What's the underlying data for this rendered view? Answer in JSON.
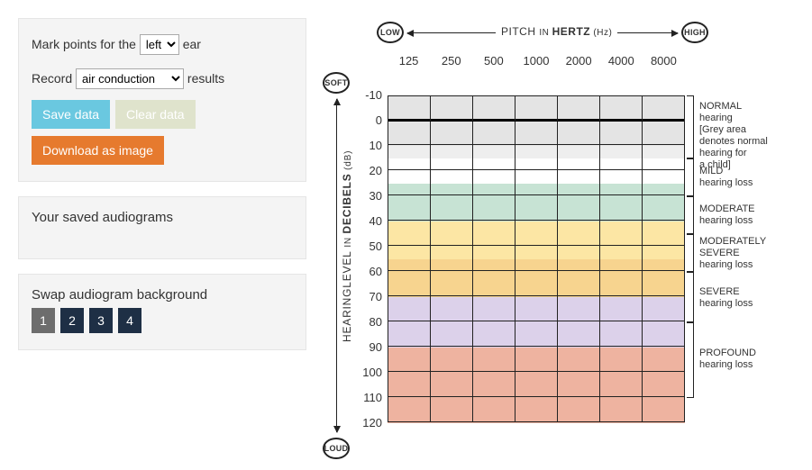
{
  "controls": {
    "mark_prefix": "Mark points for the ",
    "mark_suffix": " ear",
    "ear_value": "left",
    "record_prefix": "Record ",
    "record_suffix": " results",
    "conduction_value": "air conduction",
    "save_label": "Save data",
    "clear_label": "Clear data",
    "download_label": "Download as image"
  },
  "saved": {
    "heading": "Your saved audiograms"
  },
  "swap": {
    "heading": "Swap audiogram background",
    "options": [
      "1",
      "2",
      "3",
      "4"
    ],
    "active": "1"
  },
  "chart_data": {
    "type": "heatmap",
    "title_x_main": "PITCH ",
    "title_x_sub": "IN ",
    "title_x_sub2": "HERTZ",
    "title_x_sub3": " (Hz)",
    "title_y_main": "HEARINGLEVEL ",
    "title_y_sub": "IN ",
    "title_y_sub2": "DECIBELS",
    "title_y_sub3": " (dB)",
    "badge_low": "LOW",
    "badge_high": "HIGH",
    "badge_soft": "SOFT",
    "badge_loud": "LOUD",
    "x_ticks": [
      "125",
      "250",
      "500",
      "1000",
      "2000",
      "4000",
      "8000"
    ],
    "y_ticks": [
      "-10",
      "0",
      "10",
      "20",
      "30",
      "40",
      "50",
      "60",
      "70",
      "80",
      "90",
      "100",
      "110",
      "120"
    ],
    "bands": [
      {
        "from": -10,
        "to": 0,
        "color": "c-grey"
      },
      {
        "from": 0,
        "to": 10,
        "color": "c-grey"
      },
      {
        "from": 10,
        "to": 15,
        "color": "c-ltgrey"
      },
      {
        "from": 15,
        "to": 25,
        "color": "c-white"
      },
      {
        "from": 25,
        "to": 40,
        "color": "c-green"
      },
      {
        "from": 40,
        "to": 55,
        "color": "c-yellow"
      },
      {
        "from": 55,
        "to": 70,
        "color": "c-gold"
      },
      {
        "from": 70,
        "to": 90,
        "color": "c-lav"
      },
      {
        "from": 90,
        "to": 120,
        "color": "c-salmon"
      }
    ],
    "severity": {
      "normal_title": "NORMAL",
      "normal_l1": "hearing",
      "normal_l2": "[Grey area",
      "normal_l3": "denotes normal",
      "normal_l4": "hearing for",
      "normal_l5": "a child]",
      "mild_title": "MILD",
      "mild_l1": "hearing loss",
      "moderate_title": "MODERATE",
      "moderate_l1": "hearing loss",
      "modsev_title": "MODERATELY",
      "modsev_title2": "SEVERE",
      "modsev_l1": "hearing loss",
      "severe_title": "SEVERE",
      "severe_l1": "hearing loss",
      "profound_title": "PROFOUND",
      "profound_l1": "hearing loss"
    }
  }
}
